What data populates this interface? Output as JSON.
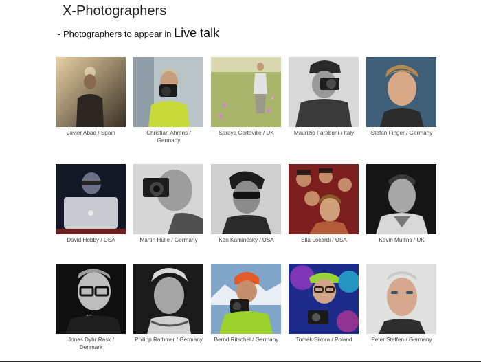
{
  "header": {
    "title": "X-Photographers",
    "subtitle_prefix": "- Photographers to appear in",
    "subtitle_highlight": "Live talk"
  },
  "photographers": [
    {
      "caption": "Javier Abad / Spain"
    },
    {
      "caption": "Christian Ahrens / Germany"
    },
    {
      "caption": "Saraya Cortaville / UK"
    },
    {
      "caption": "Maurizio Faraboni / Italy"
    },
    {
      "caption": "Stefan Finger / Germany"
    },
    {
      "caption": "David Hobby / USA"
    },
    {
      "caption": "Martin Hülle / Germany"
    },
    {
      "caption": "Ken Kaminesky / USA"
    },
    {
      "caption": "Elia Locardi / USA"
    },
    {
      "caption": "Kevin Mullins / UK"
    },
    {
      "caption": "Jonas Dyhr Rask / Denmark"
    },
    {
      "caption": "Philipp Rathmer / Germany"
    },
    {
      "caption": "Bernd Ritschel / Germany"
    },
    {
      "caption": "Tomek Sikora / Poland"
    },
    {
      "caption": "Peter Steffen / Germany"
    }
  ]
}
